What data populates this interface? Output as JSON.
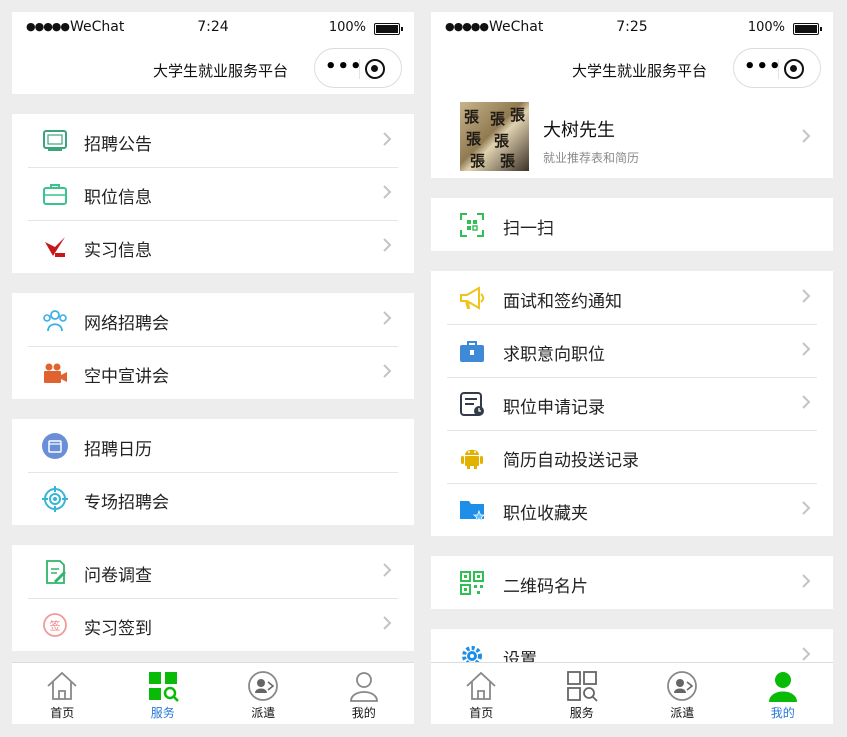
{
  "left": {
    "status": {
      "carrier": "WeChat",
      "time": "7:24",
      "battery": "100%"
    },
    "title": "大学生就业服务平台",
    "groups": [
      [
        {
          "label": "招聘公告",
          "icon": "notice-icon"
        },
        {
          "label": "职位信息",
          "icon": "briefcase-icon"
        },
        {
          "label": "实习信息",
          "icon": "badge-icon"
        }
      ],
      [
        {
          "label": "网络招聘会",
          "icon": "group-icon"
        },
        {
          "label": "空中宣讲会",
          "icon": "video-camera-icon"
        }
      ],
      [
        {
          "label": "招聘日历",
          "icon": "calendar-icon"
        },
        {
          "label": "专场招聘会",
          "icon": "target-icon"
        }
      ],
      [
        {
          "label": "问卷调查",
          "icon": "survey-icon"
        },
        {
          "label": "实习签到",
          "icon": "signin-icon"
        }
      ]
    ],
    "tabs": [
      "首页",
      "服务",
      "派遣",
      "我的"
    ]
  },
  "right": {
    "status": {
      "carrier": "WeChat",
      "time": "7:25",
      "battery": "100%"
    },
    "title": "大学生就业服务平台",
    "profile": {
      "name": "大树先生",
      "subtitle": "就业推荐表和简历"
    },
    "scan": "扫一扫",
    "group1": [
      "面试和签约通知",
      "求职意向职位",
      "职位申请记录",
      "简历自动投送记录",
      "职位收藏夹"
    ],
    "qrcode": "二维码名片",
    "settings": "设置",
    "tabs": [
      "首页",
      "服务",
      "派遣",
      "我的"
    ]
  },
  "colors": {
    "active_tab": "#2878d6",
    "green": "#09bb07",
    "arrow": "#c4c4c4"
  }
}
